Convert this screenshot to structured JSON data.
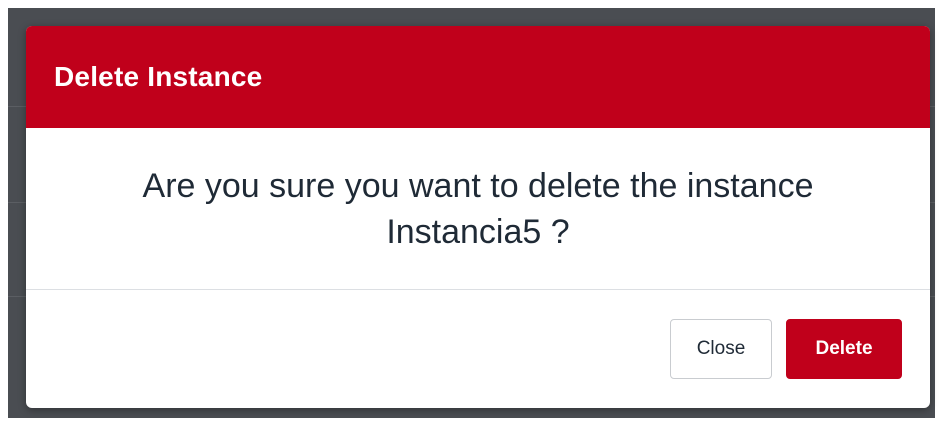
{
  "dialog": {
    "title": "Delete Instance",
    "message_line1": "Are you sure you want to delete the instance",
    "message_line2": "Instancia5 ?",
    "close_label": "Close",
    "delete_label": "Delete"
  },
  "colors": {
    "accent": "#c0001b",
    "text": "#1f2a36",
    "backdrop": "#4a4d52"
  }
}
